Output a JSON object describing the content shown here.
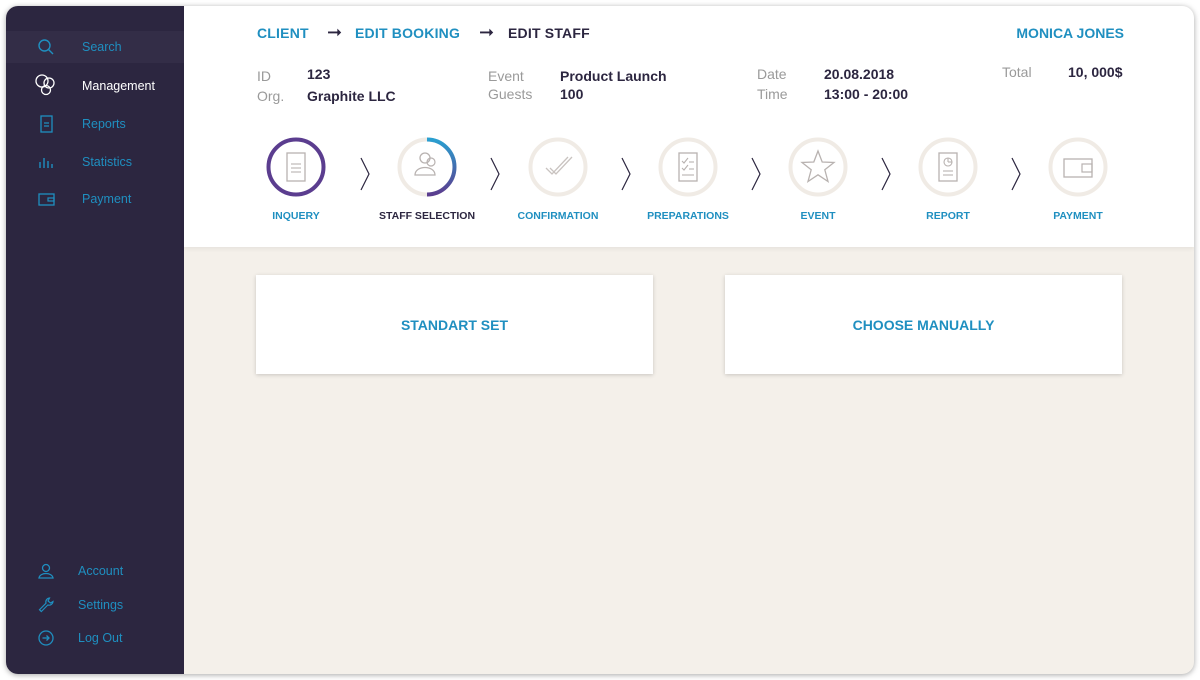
{
  "colors": {
    "sidebar_bg": "#2c2640",
    "accent": "#1f8fc0",
    "step_active": "#5b3d8f",
    "content_bg": "#f4f0ea"
  },
  "sidebar": {
    "top_items": [
      {
        "label": "Search",
        "icon": "search-icon"
      },
      {
        "label": "Management",
        "icon": "management-icon"
      },
      {
        "label": "Reports",
        "icon": "reports-icon"
      },
      {
        "label": "Statistics",
        "icon": "statistics-icon"
      },
      {
        "label": "Payment",
        "icon": "payment-icon"
      }
    ],
    "bottom_items": [
      {
        "label": "Account",
        "icon": "account-icon"
      },
      {
        "label": "Settings",
        "icon": "wrench-icon"
      },
      {
        "label": "Log Out",
        "icon": "logout-icon"
      }
    ]
  },
  "breadcrumb": {
    "items": [
      "CLIENT",
      "EDIT BOOKING",
      "EDIT STAFF"
    ],
    "separator": "➞"
  },
  "user": {
    "name": "MONICA JONES"
  },
  "booking": {
    "id_label": "ID",
    "id_value": "123",
    "org_label": "Org.",
    "org_value": "Graphite LLC",
    "event_label": "Event",
    "event_value": "Product Launch",
    "guests_label": "Guests",
    "guests_value": "100",
    "date_label": "Date",
    "date_value": "20.08.2018",
    "time_label": "Time",
    "time_value": "13:00 - 20:00",
    "total_label": "Total",
    "total_value": "10, 000$"
  },
  "steps": [
    {
      "label": "INQUERY",
      "icon": "document-icon",
      "status": "done"
    },
    {
      "label": "STAFF SELECTION",
      "icon": "person-icon",
      "status": "current",
      "progress": 0.5
    },
    {
      "label": "CONFIRMATION",
      "icon": "checkmark-icon",
      "status": "pending"
    },
    {
      "label": "PREPARATIONS",
      "icon": "checklist-icon",
      "status": "pending"
    },
    {
      "label": "EVENT",
      "icon": "star-icon",
      "status": "pending"
    },
    {
      "label": "REPORT",
      "icon": "report-icon",
      "status": "pending"
    },
    {
      "label": "PAYMENT",
      "icon": "wallet-icon",
      "status": "pending"
    }
  ],
  "options": {
    "standard_label": "STANDART SET",
    "manual_label": "CHOOSE MANUALLY"
  }
}
